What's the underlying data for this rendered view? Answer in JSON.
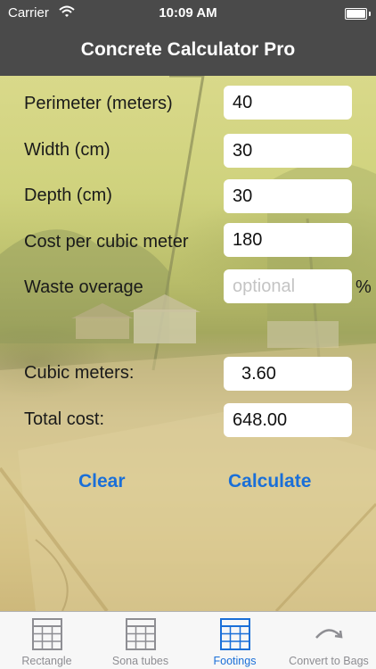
{
  "status": {
    "carrier": "Carrier",
    "time": "10:09 AM"
  },
  "nav": {
    "title": "Concrete Calculator Pro"
  },
  "form": {
    "perimeter": {
      "label": "Perimeter (meters)",
      "value": "40"
    },
    "width": {
      "label": "Width (cm)",
      "value": "30"
    },
    "depth": {
      "label": "Depth (cm)",
      "value": "30"
    },
    "cost": {
      "label": "Cost per cubic meter",
      "value": "180"
    },
    "waste": {
      "label": "Waste overage",
      "placeholder": "optional",
      "unit": "%"
    }
  },
  "results": {
    "cubic": {
      "label": "Cubic meters:",
      "value": "3.60"
    },
    "total": {
      "label": "Total cost:",
      "value": "648.00"
    }
  },
  "actions": {
    "clear": "Clear",
    "calculate": "Calculate"
  },
  "tabs": [
    {
      "label": "Rectangle",
      "icon": "grid-icon",
      "active": false
    },
    {
      "label": "Sona tubes",
      "icon": "grid-icon",
      "active": false
    },
    {
      "label": "Footings",
      "icon": "grid-icon",
      "active": true
    },
    {
      "label": "Convert to Bags",
      "icon": "curved-arrow-icon",
      "active": false
    }
  ],
  "colors": {
    "bar": "#4a4a4a",
    "accent": "#1a6fd8",
    "tab_inactive": "#8e8e93"
  }
}
